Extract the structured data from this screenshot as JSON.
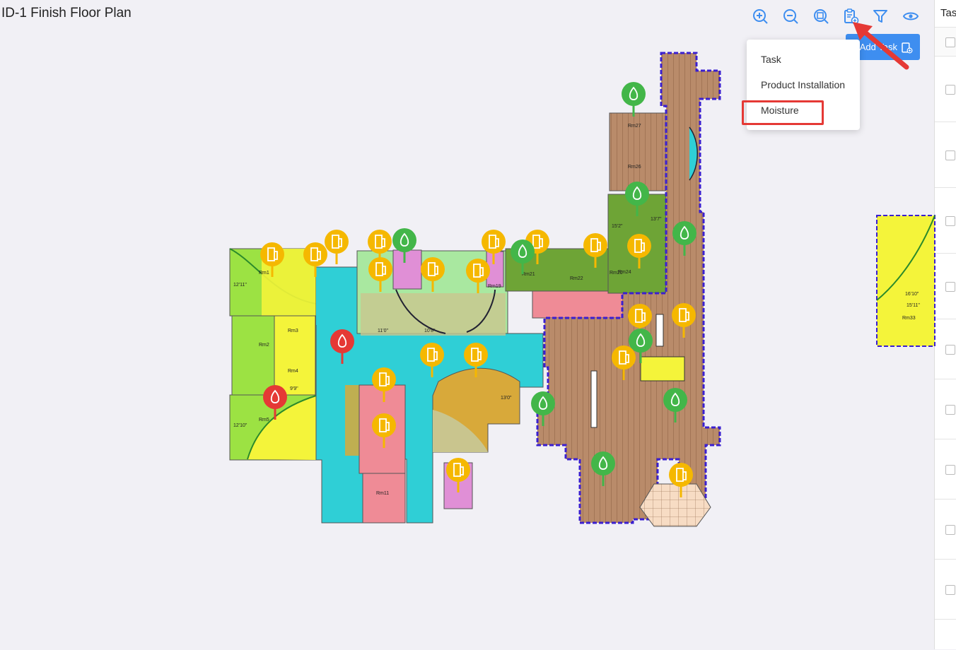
{
  "page": {
    "title": "ID-1 Finish Floor Plan"
  },
  "toolbar": {
    "icons": [
      "zoom-in-icon",
      "zoom-out-icon",
      "zoom-fit-icon",
      "add-task-icon",
      "filter-icon",
      "eye-icon"
    ]
  },
  "add_button": {
    "label": "Add Task"
  },
  "menu": {
    "items": [
      "Task",
      "Product Installation",
      "Moisture"
    ],
    "highlighted": "Moisture"
  },
  "right_panel": {
    "header": "Tas"
  },
  "plan": {
    "room_labels": [
      "Rm1",
      "Rm2",
      "Rm3",
      "Rm4",
      "Rm5",
      "Rm11",
      "Rm19",
      "Rm20",
      "Rm21",
      "Rm22",
      "Rm24",
      "Rm26",
      "Rm27",
      "Rm33"
    ],
    "dimension_labels": [
      "13'7\"",
      "15'2\"",
      "10'8\"",
      "11'0\"",
      "13'0\"",
      "12'11\"",
      "15'11\"",
      "16'10\"",
      "9'9\"",
      "12'10\""
    ]
  },
  "colors": {
    "accent": "#3e8ef0",
    "pin_yellow": "#f5b800",
    "pin_green": "#43b649",
    "pin_red": "#e53935",
    "highlight": "#e53935"
  }
}
